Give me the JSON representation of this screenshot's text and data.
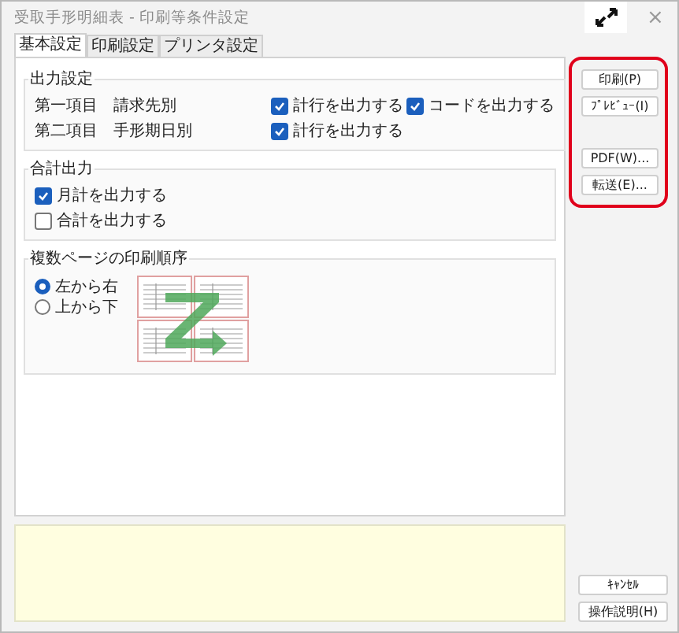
{
  "window": {
    "title": "受取手形明細表 - 印刷等条件設定",
    "close": "×"
  },
  "tabs": [
    {
      "label": "基本設定",
      "selected": true
    },
    {
      "label": "印刷設定",
      "selected": false
    },
    {
      "label": "プリンタ設定",
      "selected": false
    }
  ],
  "output_settings": {
    "title": "出力設定",
    "rows": [
      {
        "item": "第一項目",
        "value": "請求先別",
        "options": [
          {
            "label": "計行を出力する",
            "checked": true
          },
          {
            "label": "コードを出力する",
            "checked": true
          }
        ]
      },
      {
        "item": "第二項目",
        "value": "手形期日別",
        "options": [
          {
            "label": "計行を出力する",
            "checked": true
          }
        ]
      }
    ]
  },
  "totals": {
    "title": "合計出力",
    "options": [
      {
        "label": "月計を出力する",
        "checked": true
      },
      {
        "label": "合計を出力する",
        "checked": false
      }
    ]
  },
  "page_order": {
    "title": "複数ページの印刷順序",
    "options": [
      {
        "label": "左から右",
        "selected": true
      },
      {
        "label": "上から下",
        "selected": false
      }
    ]
  },
  "side_button_groups": [
    {
      "buttons": [
        {
          "label": "印刷(P)"
        },
        {
          "label": "ﾌﾟﾚﾋﾞｭｰ(I)"
        }
      ]
    },
    {
      "buttons": [
        {
          "label": "PDF(W)..."
        },
        {
          "label": "転送(E)..."
        }
      ]
    }
  ],
  "highlight": true,
  "bottom_buttons": [
    {
      "label": "ｷｬﾝｾﾙ"
    },
    {
      "label": "操作説明(H)"
    }
  ]
}
